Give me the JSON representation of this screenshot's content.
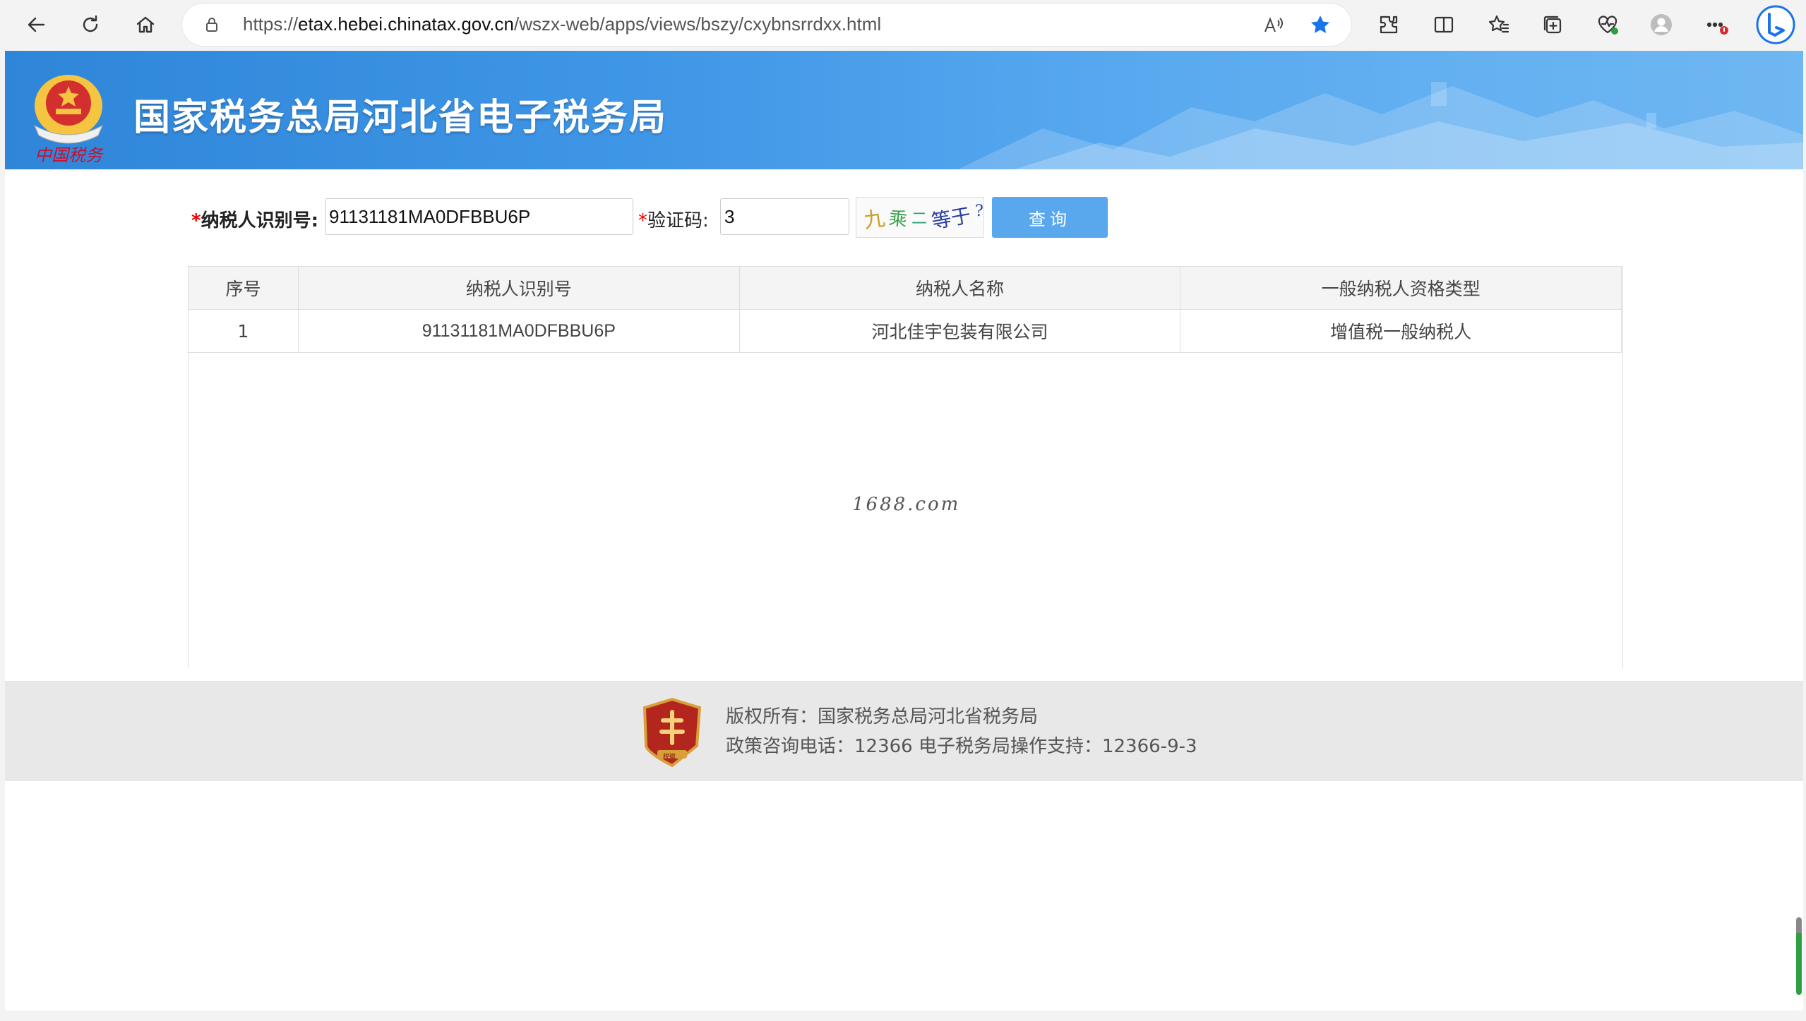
{
  "browser": {
    "url_prefix": "https://",
    "url_host": "etax.hebei.chinatax.gov.cn",
    "url_path": "/wszx-web/apps/views/bszy/cxybnsrrdxx.html"
  },
  "header": {
    "emblem_text": "中国税务",
    "site_title": "国家税务总局河北省电子税务局"
  },
  "form": {
    "required_mark": "*",
    "taxpayer_id_label": "纳税人识别号:",
    "taxpayer_id_value": "91131181MA0DFBBU6P",
    "captcha_label": "验证码:",
    "captcha_value": "3",
    "captcha_image_chars": [
      "九",
      "乘",
      "二",
      "等于",
      "?"
    ],
    "query_button": "查询"
  },
  "table": {
    "headers": [
      "序号",
      "纳税人识别号",
      "纳税人名称",
      "一般纳税人资格类型"
    ],
    "rows": [
      [
        "1",
        "91131181MA0DFBBU6P",
        "河北佳宇包装有限公司",
        "增值税一般纳税人"
      ]
    ]
  },
  "watermark": "1688.com",
  "footer": {
    "copyright": "版权所有：国家税务总局河北省税务局",
    "contact": "政策咨询电话：12366  电子税务局操作支持：12366-9-3",
    "logo_text": "税徽"
  },
  "colors": {
    "banner": "#3f96e6",
    "button": "#59a7ec",
    "required": "#e00000",
    "footer_bg": "#e8e8e8"
  }
}
